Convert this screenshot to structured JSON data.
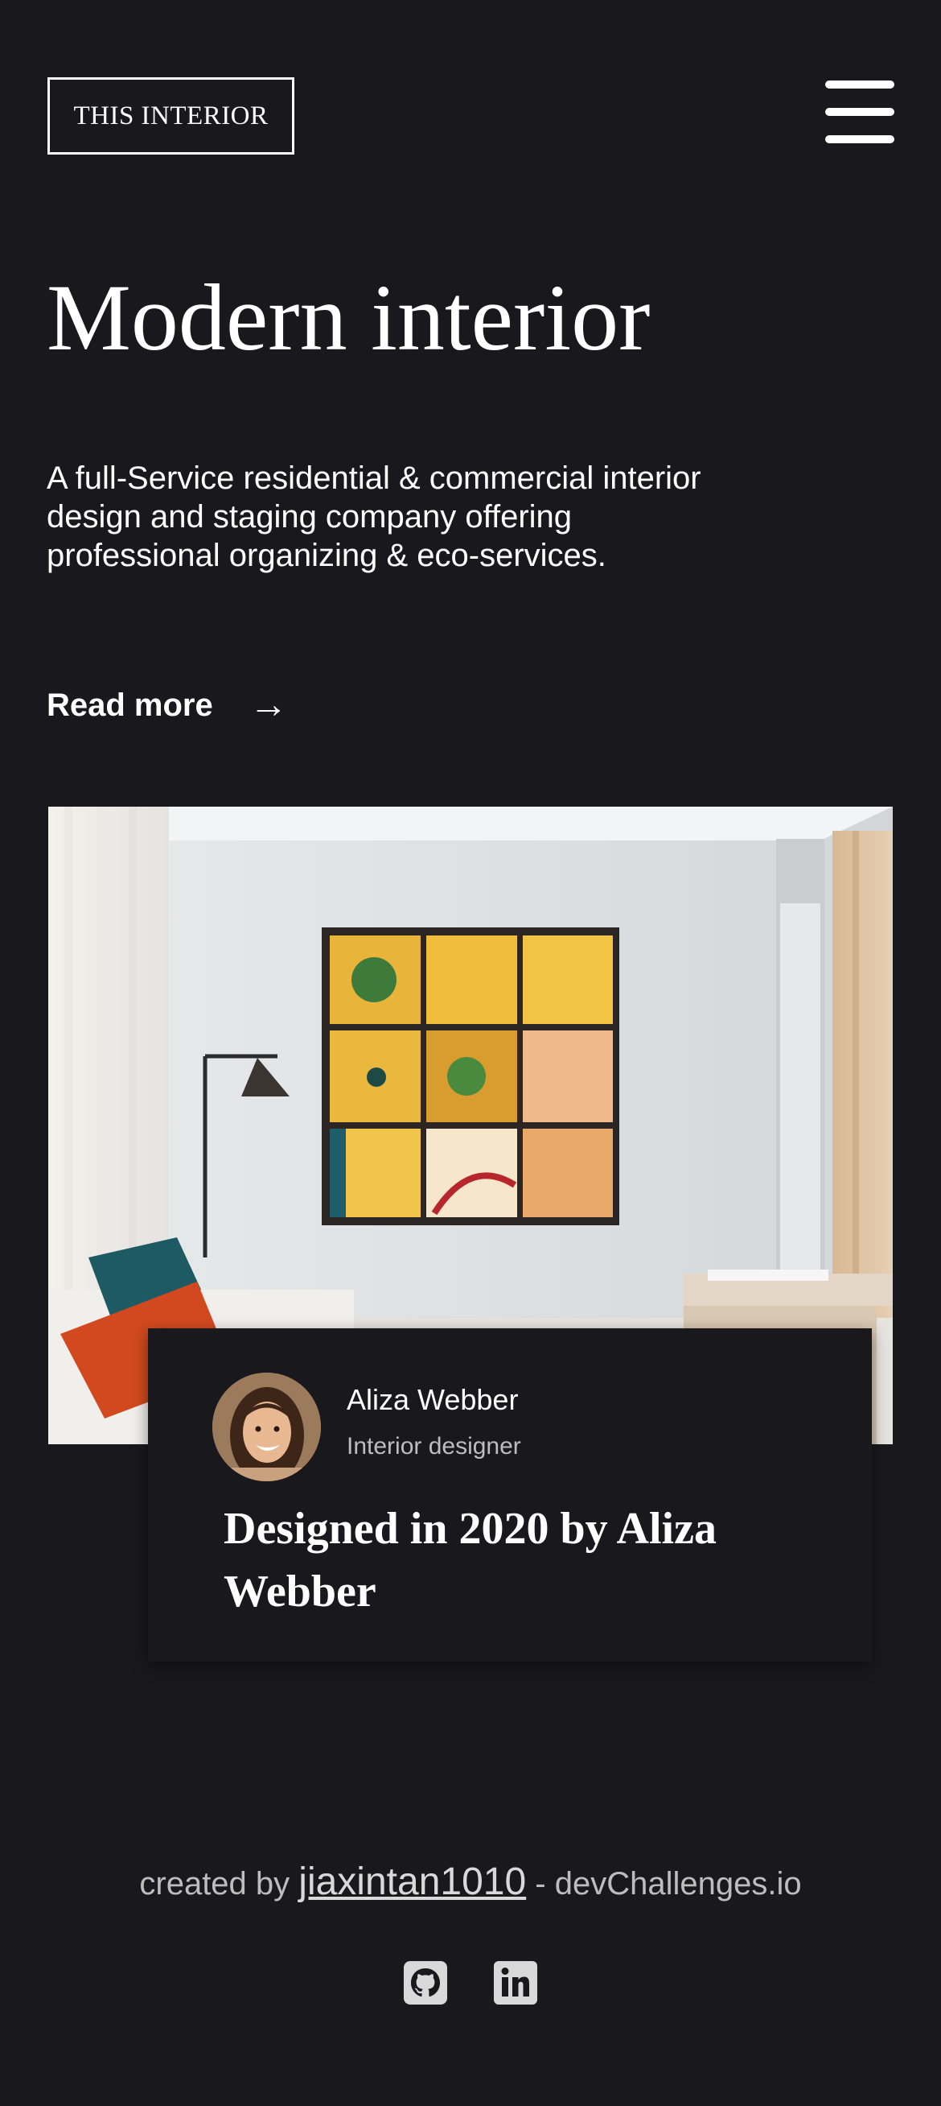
{
  "header": {
    "logo_text": "THIS INTERIOR",
    "menu_icon": "hamburger-menu-icon"
  },
  "hero": {
    "title": "Modern interior",
    "description": "A full-Service residential & commercial interior design and staging company offering professional organizing & eco-services.",
    "read_more_label": "Read more",
    "read_more_icon": "arrow-right-icon"
  },
  "feature": {
    "designer_name": "Aliza Webber",
    "designer_role": "Interior designer",
    "caption": "Designed in 2020 by Aliza Webber"
  },
  "footer": {
    "created_by": "created by",
    "author": "jiaxintan1010",
    "separator": "-",
    "site": "devChallenges.io",
    "social_icons": [
      "github-icon",
      "linkedin-icon"
    ]
  },
  "colors": {
    "background": "#19181c",
    "text": "#ffffff",
    "muted_text": "#bdbdbd"
  }
}
